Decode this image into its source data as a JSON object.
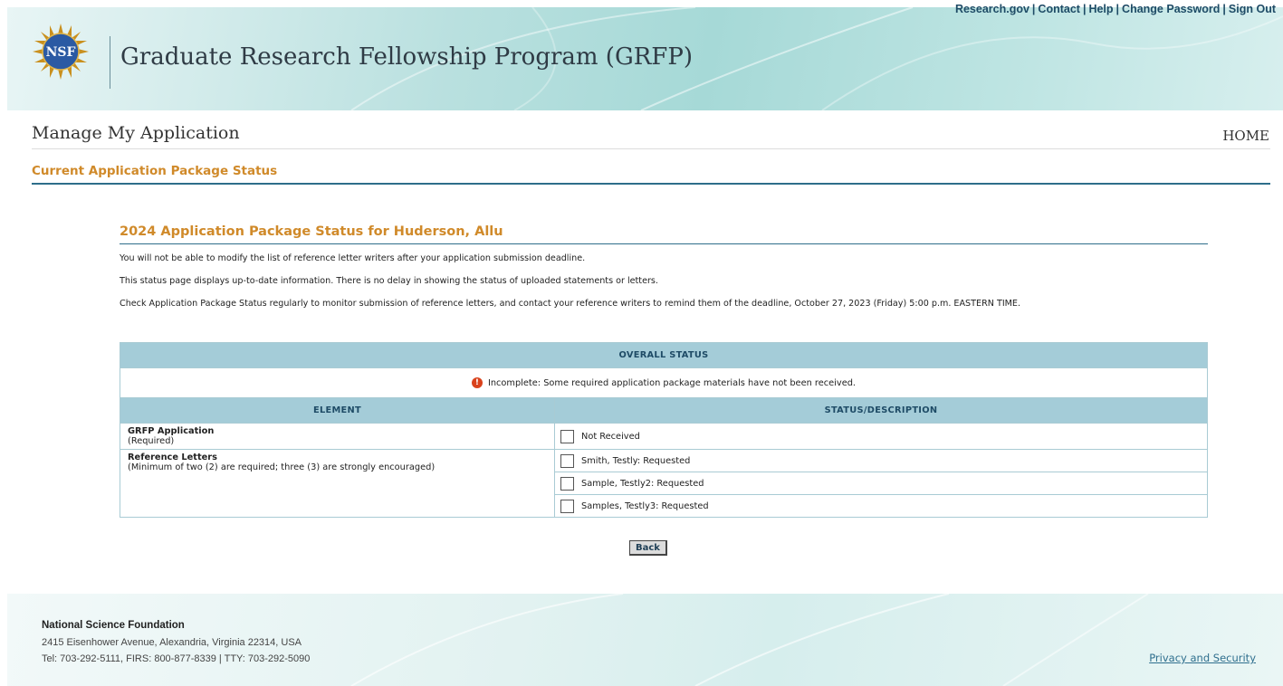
{
  "header": {
    "program_title": "Graduate Research Fellowship Program (GRFP)",
    "logo_text": "NSF",
    "links": {
      "research_gov": "Research.gov",
      "contact": "Contact",
      "help": "Help",
      "change_password": "Change Password",
      "sign_out": "Sign Out"
    }
  },
  "page": {
    "title": "Manage My Application",
    "home": "HOME",
    "section_title": "Current Application Package Status"
  },
  "package": {
    "title": "2024 Application Package Status for Huderson, Allu",
    "paragraphs": [
      "You will not be able to modify the list of reference letter writers after your application submission deadline.",
      "This status page displays up-to-date information. There is no delay in showing the status of uploaded statements or letters.",
      "Check Application Package Status regularly to monitor submission of reference letters, and contact your reference writers to remind them of the deadline, October 27, 2023 (Friday) 5:00 p.m. EASTERN TIME."
    ]
  },
  "status_table": {
    "overall_header": "OVERALL STATUS",
    "overall_icon": "warning-icon",
    "overall_text": "Incomplete: Some required application package materials have not been received.",
    "col_element": "ELEMENT",
    "col_status": "STATUS/DESCRIPTION",
    "rows": [
      {
        "name": "GRFP Application",
        "note": "(Required)",
        "items": [
          "Not Received"
        ]
      },
      {
        "name": "Reference Letters",
        "note": "(Minimum of two (2) are required; three (3) are strongly encouraged)",
        "items": [
          "Smith, Testly: Requested",
          "Sample, Testly2: Requested",
          "Samples, Testly3: Requested"
        ]
      }
    ]
  },
  "back_button": "Back",
  "footer": {
    "org": "National Science Foundation",
    "address": "2415 Eisenhower Avenue, Alexandria, Virginia 22314, USA",
    "tel": "Tel: 703-292-5111, FIRS: 800-877-8339 | TTY: 703-292-5090",
    "privacy": "Privacy and Security"
  },
  "colors": {
    "accent_orange": "#d08a2a",
    "header_band": "#a4ccd8",
    "rule_blue": "#2e6e8a",
    "warning_red": "#d9421c"
  }
}
